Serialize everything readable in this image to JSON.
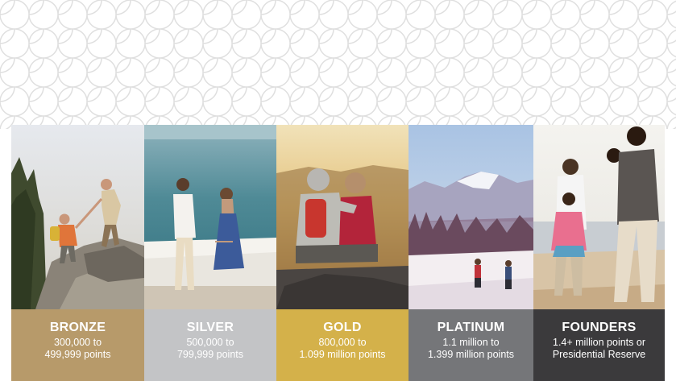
{
  "colors": {
    "bronze": "#b79a6a",
    "silver": "#c3c4c6",
    "gold": "#d4b14a",
    "platinum": "#757679",
    "founders": "#3b3a3c"
  },
  "tiers": [
    {
      "name": "BRONZE",
      "line1": "300,000 to",
      "line2": "499,999 points",
      "image": "hikers-on-rocks-photo"
    },
    {
      "name": "SILVER",
      "line1": "500,000 to",
      "line2": "799,999 points",
      "image": "couple-by-sea-photo"
    },
    {
      "name": "GOLD",
      "line1": "800,000 to",
      "line2": "1.099 million points",
      "image": "couple-at-sunset-photo"
    },
    {
      "name": "PLATINUM",
      "line1": "1.1 million to",
      "line2": "1.399 million points",
      "image": "skiers-in-snow-photo"
    },
    {
      "name": "FOUNDERS",
      "line1": "1.4+ million points or",
      "line2": "Presidential Reserve",
      "image": "family-on-beach-photo"
    }
  ]
}
